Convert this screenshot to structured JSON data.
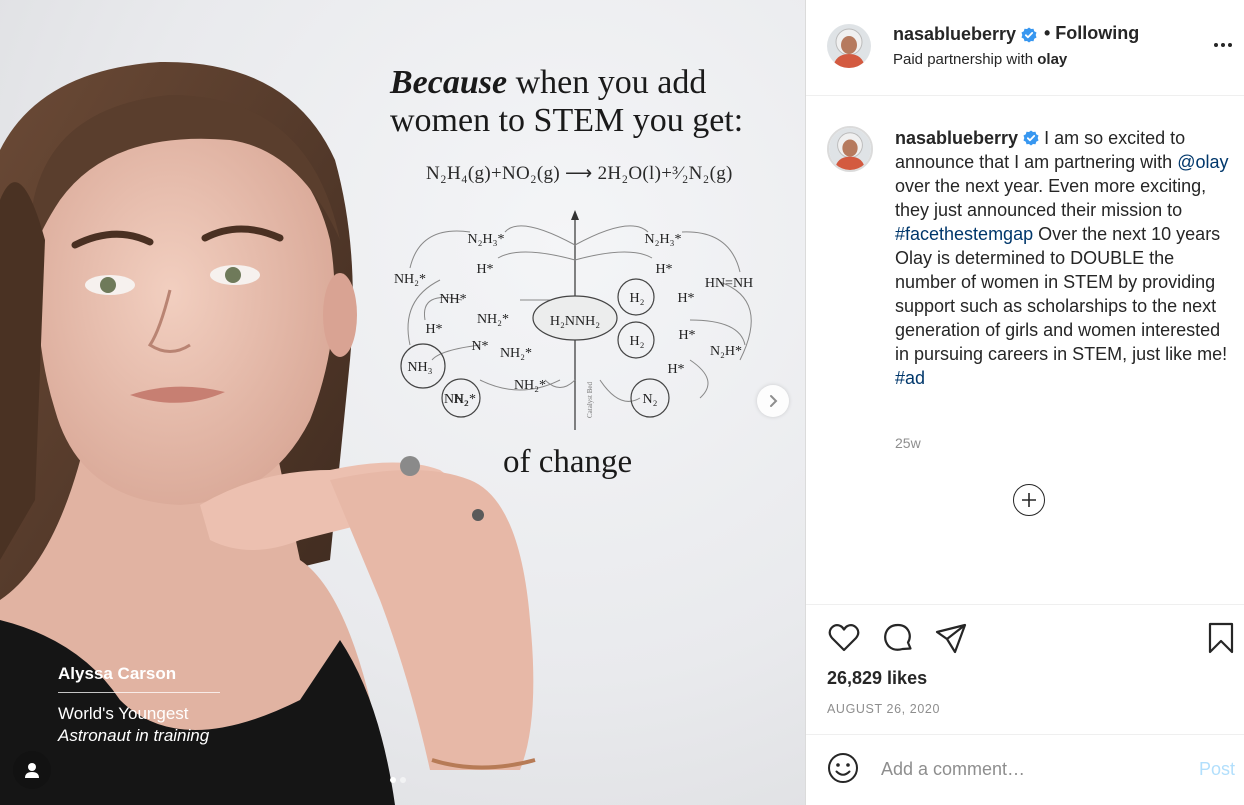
{
  "post": {
    "image": {
      "headline_bold": "Because",
      "headline_rest": " when you add women to STEM you get:",
      "equation": "N₂H₄(g)+NO₂(g)  ⟶  2H₂O(l)+³⁄₂N₂(g)",
      "diagram_labels": [
        "N₂H₃*",
        "N₂H₃*",
        "NH₂*",
        "H*",
        "H*",
        "HN=NH",
        "NH*",
        "NH₂*",
        "H₂",
        "H*",
        "H*",
        "NH₂*",
        "H₂NNH₂",
        "H₂",
        "H*",
        "N₂H*",
        "N*",
        "NH₃",
        "NH₂*",
        "H*",
        "NH₂*",
        "N₂",
        "N₂",
        "Catalyst Bed"
      ],
      "tagline": "of change",
      "caption_name": "Alyssa Carson",
      "caption_line1": "World's Youngest",
      "caption_line2": "Astronaut in training",
      "carousel_count": 2,
      "carousel_active": 1
    },
    "header": {
      "username": "nasablueberry",
      "follow_status": "• Following",
      "subtitle_prefix": "Paid partnership with",
      "partner": "olay"
    },
    "caption": {
      "username": "nasablueberry",
      "text_1": " I am so excited to announce that I am partnering with ",
      "mention": "@olay",
      "text_2": " over the next year. Even more exciting, they just announced their mission to ",
      "hashtag_1": "#facethestemgap",
      "text_3": " Over the next 10 years Olay is determined to DOUBLE the number of women in STEM by providing support such as scholarships to the next generation of girls and women interested in pursuing careers in STEM, just like me! ",
      "hashtag_2": "#ad",
      "time_ago": "25w"
    },
    "likes": "26,829 likes",
    "date": "AUGUST 26, 2020",
    "comment_box": {
      "placeholder": "Add a comment…",
      "post_label": "Post"
    },
    "icons": {
      "verified": "verified-badge-icon",
      "like": "heart-icon",
      "comment": "comment-bubble-icon",
      "share": "paper-plane-icon",
      "save": "bookmark-icon",
      "emoji": "smiley-icon",
      "more": "more-options-icon",
      "next": "chevron-right-icon",
      "load_more": "plus-circle-icon",
      "tag": "user-tag-icon"
    },
    "colors": {
      "link": "#00376b",
      "verified": "#3897f0",
      "post_disabled": "#b2dffc",
      "muted": "#8e8e8e"
    }
  }
}
